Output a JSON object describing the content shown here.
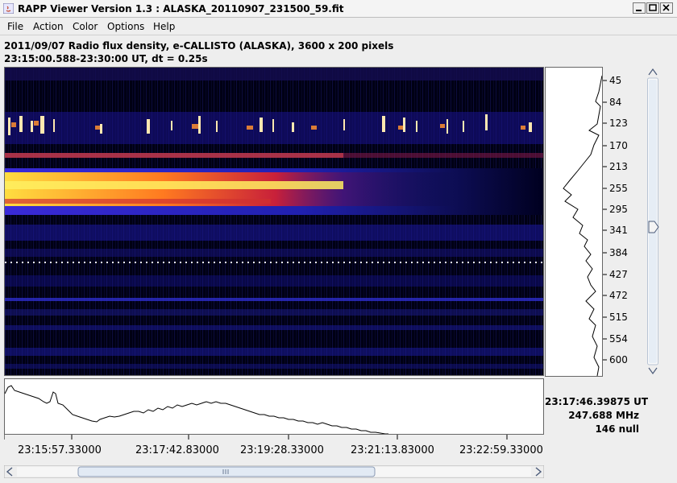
{
  "window": {
    "title": "RAPP Viewer Version 1.3 : ALASKA_20110907_231500_59.fit"
  },
  "menu": [
    "File",
    "Action",
    "Color",
    "Options",
    "Help"
  ],
  "info": {
    "line1": "2011/09/07  Radio flux density, e-CALLISTO (ALASKA),  3600 x 200 pixels",
    "line2": "23:15:00.588-23:30:00 UT,  dt = 0.25s"
  },
  "frequency_labels": [
    "45",
    "84",
    "123",
    "170",
    "213",
    "255",
    "295",
    "341",
    "384",
    "427",
    "472",
    "515",
    "554",
    "600"
  ],
  "time_labels": [
    "23:15:57.33000",
    "23:17:42.83000",
    "23:19:28.33000",
    "23:21:13.83000",
    "23:22:59.33000"
  ],
  "readout": {
    "time": "23:17:46.39875 UT",
    "frequency": "247.688 MHz",
    "value": "146 null"
  },
  "scroll": {
    "vertical_position": 0.52,
    "horizontal_position": 0.28
  },
  "colors": {
    "background": "#eeeeee",
    "spectrogram_bg": "#000014",
    "burst_hot": "#ffee60"
  }
}
